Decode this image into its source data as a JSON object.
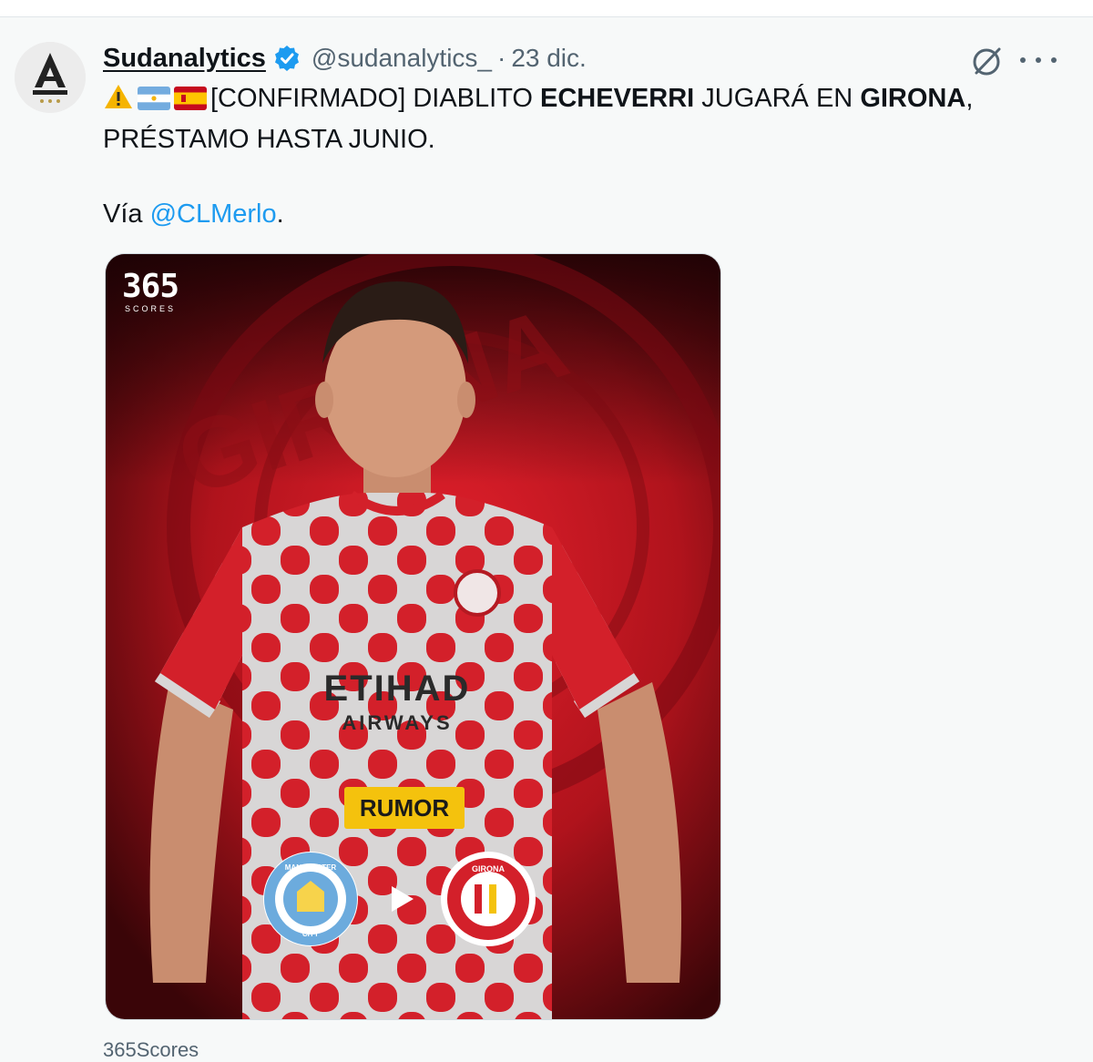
{
  "tweet": {
    "author_name": "Sudanalytics",
    "handle": "@sudanalytics_",
    "separator": "·",
    "date": "23 dic.",
    "text_part1": "[CONFIRMADO] DIABLITO ",
    "text_bold1": "ECHEVERRI",
    "text_part2": " JUGARÁ EN ",
    "text_bold2": "GIRONA",
    "text_part3": ", PRÉSTAMO HASTA JUNIO.",
    "via_prefix": "Vía ",
    "via_mention": "@CLMerlo",
    "via_suffix": "."
  },
  "icons": {
    "warning": "warning-icon",
    "flag_argentina": "flag-argentina-icon",
    "flag_spain": "flag-spain-icon",
    "verified": "verified-badge-icon",
    "grok": "grok-icon",
    "more": "more-options-icon",
    "play": "play-arrow-icon"
  },
  "media": {
    "brand_number": "365",
    "brand_sub": "SCORES",
    "badge_text": "RUMOR",
    "background_club": "GIRONA",
    "shirt_sponsor": "ETIHAD",
    "shirt_sponsor_sub": "AIRWAYS",
    "from_club_ring": "MANCHESTER",
    "from_club_city": "CITY",
    "to_club_ring": "GIRONA"
  },
  "caption": "365Scores",
  "colors": {
    "accent": "#1d9bf0",
    "text_primary": "#0f1419",
    "text_secondary": "#536471",
    "badge": "#f4c20d",
    "background": "#f7f9f9"
  }
}
